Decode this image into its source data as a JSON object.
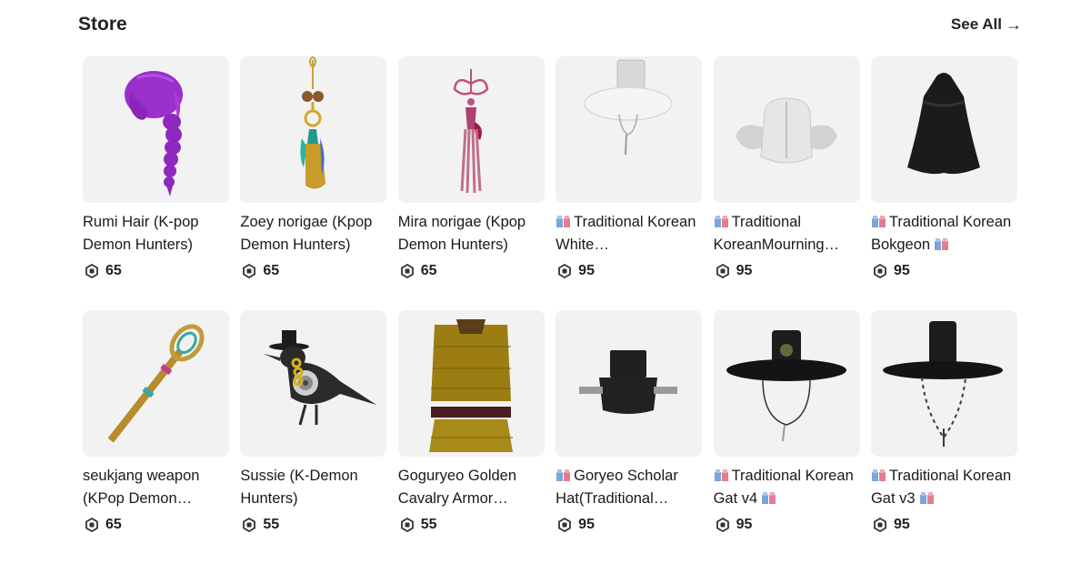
{
  "header": {
    "title": "Store",
    "see_all": "See All",
    "see_all_icon": "arrow-right-icon"
  },
  "currency_icon": "robux-icon",
  "items": [
    {
      "name": "Rumi Hair (K-pop Demon Hunters)",
      "price": "65",
      "badge": false,
      "thumb": "purple-braid-hair"
    },
    {
      "name": "Zoey norigae (Kpop Demon Hunters)",
      "price": "65",
      "badge": false,
      "thumb": "gold-norigae"
    },
    {
      "name": "Mira norigae (Kpop Demon Hunters)",
      "price": "65",
      "badge": false,
      "thumb": "pink-norigae"
    },
    {
      "name": "Traditional Korean White…",
      "price": "95",
      "badge": true,
      "thumb": "white-gat"
    },
    {
      "name": "Traditional KoreanMourning…",
      "price": "95",
      "badge": true,
      "thumb": "mourning-hat"
    },
    {
      "name": "Traditional Korean Bokgeon",
      "price": "95",
      "badge": true,
      "badge_end": true,
      "thumb": "black-bokgeon"
    },
    {
      "name": "seukjang weapon (KPop Demon…",
      "price": "65",
      "badge": false,
      "thumb": "staff-weapon"
    },
    {
      "name": "Sussie (K-Demon Hunters)",
      "price": "55",
      "badge": false,
      "thumb": "crow"
    },
    {
      "name": "Goguryeo Golden Cavalry Armor…",
      "price": "55",
      "badge": false,
      "thumb": "golden-armor"
    },
    {
      "name": "Goryeo Scholar Hat(Traditional…",
      "price": "95",
      "badge": true,
      "thumb": "scholar-hat"
    },
    {
      "name": "Traditional Korean Gat v4",
      "price": "95",
      "badge": true,
      "badge_end": true,
      "thumb": "black-gat-v4"
    },
    {
      "name": "Traditional Korean Gat v3",
      "price": "95",
      "badge": true,
      "badge_end": true,
      "thumb": "black-gat-v3"
    }
  ]
}
